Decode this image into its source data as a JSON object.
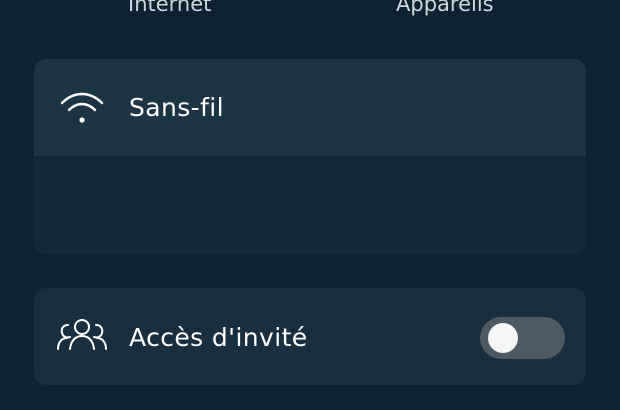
{
  "top_tabs": {
    "internet": "Internet",
    "devices": "Appareils"
  },
  "wireless_card": {
    "title": "Sans-fil",
    "icon": "wifi-icon",
    "network_name_redacted": true,
    "action_icon": "external-link-icon"
  },
  "guest_access_card": {
    "title": "Accès d'invité",
    "icon": "users-icon",
    "toggle_enabled": false
  },
  "colors": {
    "background": "#0e2331",
    "card": "#172f40",
    "header": "#1b3546",
    "subrow": "#12293a",
    "text": "#ffffff",
    "toggle_off": "#4d5a63"
  }
}
